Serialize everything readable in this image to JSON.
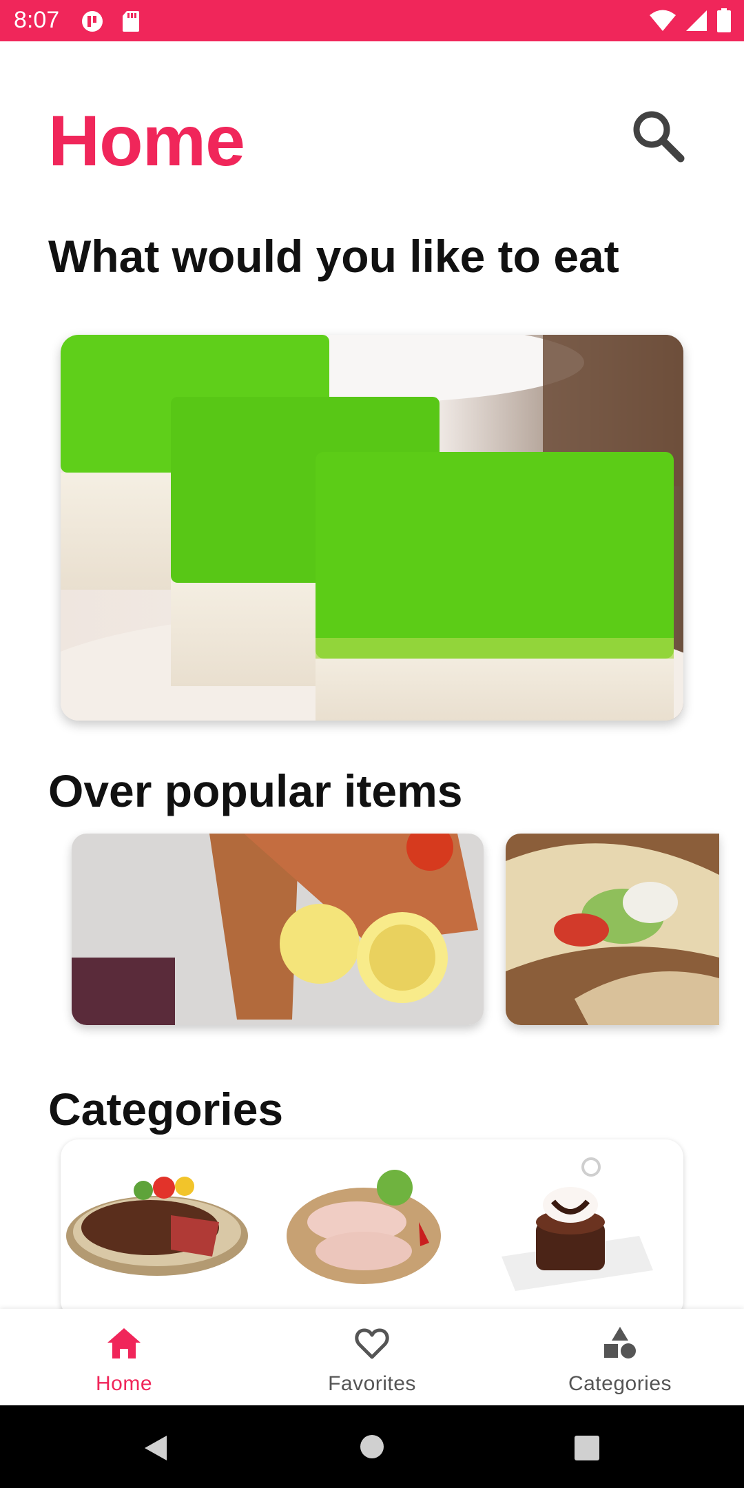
{
  "status_bar": {
    "time": "8:07"
  },
  "header": {
    "title": "Home",
    "search_icon": "search-icon"
  },
  "hero_section": {
    "heading": "What would you like to eat"
  },
  "popular_section": {
    "heading": "Over popular items"
  },
  "categories_section": {
    "heading": "Categories"
  },
  "bottom_nav": {
    "items": [
      {
        "label": "Home",
        "icon": "home-icon",
        "active": true
      },
      {
        "label": "Favorites",
        "icon": "heart-icon",
        "active": false
      },
      {
        "label": "Categories",
        "icon": "shapes-icon",
        "active": false
      }
    ]
  },
  "colors": {
    "accent": "#f0265a",
    "text": "#111111",
    "muted": "#555555"
  }
}
